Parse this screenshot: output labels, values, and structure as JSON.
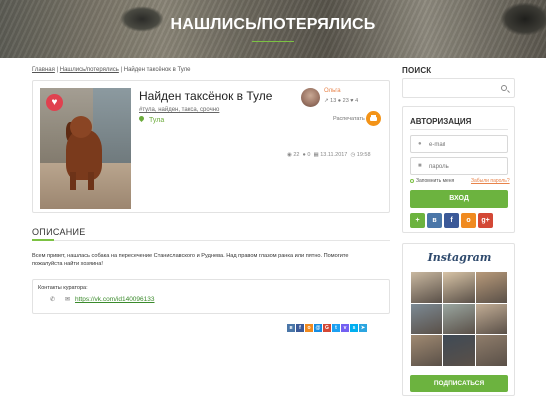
{
  "header": {
    "title": "НАШЛИСЬ/ПОТЕРЯЛИСЬ"
  },
  "breadcrumb": {
    "home": "Главная",
    "section": "Нашлись/потерялись",
    "current": "Найден таксёнок в Туле"
  },
  "ad": {
    "title": "Найден таксёнок в Туле",
    "tags": "#тула, найден, такса, срочно",
    "city": "Тула",
    "author": {
      "name": "Ольга",
      "stats": "↗ 13  ● 23  ♥ 4"
    },
    "print_label": "Распечатать",
    "meta": {
      "views": "22",
      "comments": "0",
      "date": "13.11.2017",
      "time": "19:58"
    }
  },
  "description": {
    "heading": "ОПИСАНИЕ",
    "text": "Всем привет, нашлась собака на пересечение Станиславского и Руднева. Над правом глазом ранка или пятно. Помогите пожалуйста найти хозяина!"
  },
  "contacts": {
    "label": "Контакты куратора:",
    "link": "https://vk.com/id140096133"
  },
  "share_icons": [
    {
      "name": "vk",
      "glyph": "в",
      "color": "#4a76a8"
    },
    {
      "name": "facebook",
      "glyph": "f",
      "color": "#3b5998"
    },
    {
      "name": "odnoklassniki",
      "glyph": "o",
      "color": "#f08a1f"
    },
    {
      "name": "moimir",
      "glyph": "@",
      "color": "#168de2"
    },
    {
      "name": "googleplus",
      "glyph": "G",
      "color": "#d34836"
    },
    {
      "name": "twitter",
      "glyph": "t",
      "color": "#1da1f2"
    },
    {
      "name": "viber",
      "glyph": "v",
      "color": "#7360f2"
    },
    {
      "name": "skype",
      "glyph": "s",
      "color": "#00aff0"
    },
    {
      "name": "telegram",
      "glyph": "➤",
      "color": "#2ca5e0"
    }
  ],
  "sidebar": {
    "search_heading": "ПОИСК",
    "auth": {
      "heading": "АВТОРИЗАЦИЯ",
      "email_placeholder": "e-mail",
      "password_placeholder": "пароль",
      "remember": "Запомнить меня",
      "forgot": "Забыли пароль?",
      "login": "ВХОД",
      "socials": [
        {
          "name": "add-user",
          "glyph": "+",
          "color": "#6cb33f"
        },
        {
          "name": "vk",
          "glyph": "в",
          "color": "#4a76a8"
        },
        {
          "name": "facebook",
          "glyph": "f",
          "color": "#3b5998"
        },
        {
          "name": "odnoklassniki",
          "glyph": "o",
          "color": "#f08a1f"
        },
        {
          "name": "googleplus",
          "glyph": "g+",
          "color": "#d34836"
        }
      ]
    },
    "instagram": {
      "logo": "Instagram",
      "subscribe": "ПОДПИСАТЬСЯ",
      "tiles": [
        "#c9b8a0",
        "#d8c4a6",
        "#b89a7a",
        "#7c8a94",
        "#9aa6a0",
        "#c2ad95",
        "#a08a72",
        "#3f4a56",
        "#8f7d6b"
      ]
    }
  },
  "colors": {
    "accent": "#6cb33f",
    "orange": "#f39317",
    "author": "#e8834a"
  }
}
